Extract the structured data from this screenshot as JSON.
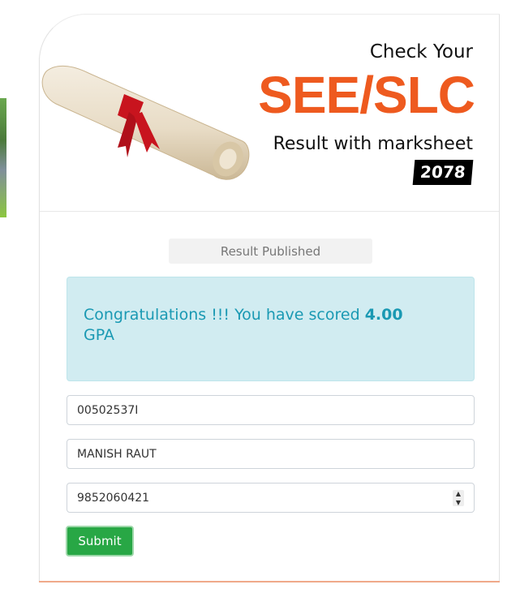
{
  "header": {
    "line1": "Check Your",
    "brand": "SEE/SLC",
    "line3": "Result with marksheet",
    "year": "2078"
  },
  "status": {
    "text": "Result Published"
  },
  "alert": {
    "prefix": "Congratulations !!! You have scored ",
    "gpa": "4.00",
    "suffix": "GPA"
  },
  "form": {
    "symbol_number": "00502537I",
    "name": "MANISH RAUT",
    "phone": "9852060421",
    "submit_label": "Submit"
  },
  "colors": {
    "brand": "#ee5a1f",
    "alert_text": "#1a99b3",
    "alert_bg": "#d1ecf1",
    "submit": "#28a745"
  }
}
